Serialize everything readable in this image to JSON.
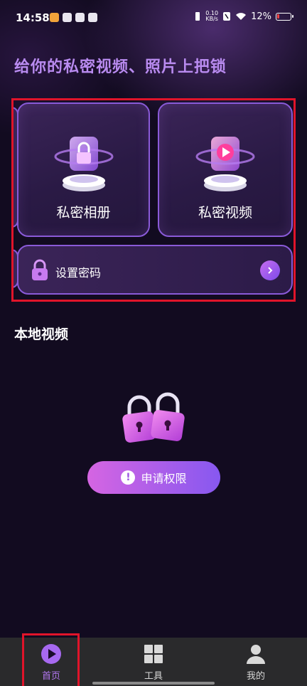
{
  "status_bar": {
    "time": "14:58",
    "net_speed_value": "0.10",
    "net_speed_unit": "KB/s",
    "battery": "12%"
  },
  "headline": "给你的私密视频、照片上把锁",
  "cards": {
    "album_label": "私密相册",
    "video_label": "私密视频"
  },
  "password": {
    "label": "设置密码"
  },
  "local_video": {
    "title": "本地视频",
    "permission_button": "申请权限"
  },
  "bottom_nav": {
    "items": [
      {
        "label": "首页",
        "icon": "play-circle-icon",
        "active": true
      },
      {
        "label": "工具",
        "icon": "grid-icon",
        "active": false
      },
      {
        "label": "我的",
        "icon": "person-icon",
        "active": false
      }
    ]
  },
  "colors": {
    "accent": "#b377f1",
    "headline": "#b98bf0",
    "background": "#120b20",
    "highlight": "#e0142a"
  }
}
